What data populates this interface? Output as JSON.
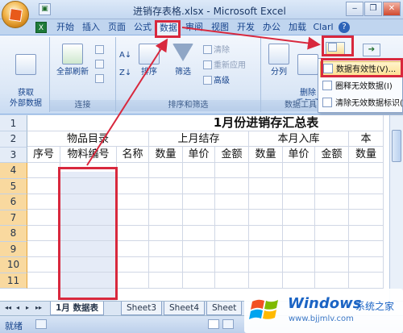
{
  "window": {
    "title": "进销存表格.xlsx - Microsoft Excel",
    "help_glyph": "?",
    "win_min": "‒",
    "win_restore": "❐",
    "win_close": "✕",
    "qat_icon": "save-icon"
  },
  "tabs": [
    {
      "label": "开始"
    },
    {
      "label": "插入"
    },
    {
      "label": "页面"
    },
    {
      "label": "公式"
    },
    {
      "label": "数据"
    },
    {
      "label": "审阅"
    },
    {
      "label": "视图"
    },
    {
      "label": "开发"
    },
    {
      "label": "办公"
    },
    {
      "label": "加载"
    },
    {
      "label": "Clarl"
    }
  ],
  "ribbon": {
    "get_external": {
      "label": "获取\n外部数据"
    },
    "connections": {
      "refresh_all": "全部刷新",
      "group_label": "连接"
    },
    "sort_filter": {
      "sort": "排序",
      "filter": "筛选",
      "clear": "清除",
      "reapply": "重新应用",
      "advanced": "高级",
      "group_label": "排序和筛选"
    },
    "data_tools": {
      "text_to_columns": "分列",
      "remove_duplicates": "删除\n重复项",
      "group_label": "数据工具"
    }
  },
  "dropdown": {
    "items": [
      {
        "label": "数据有效性(V)..."
      },
      {
        "label": "圈释无效数据(I)"
      },
      {
        "label": "清除无效数据标识(R)"
      }
    ]
  },
  "sheet": {
    "row_numbers": [
      "1",
      "2",
      "3",
      "4",
      "5",
      "6",
      "7",
      "8",
      "9",
      "10",
      "11"
    ],
    "title": "1月份进销存汇总表",
    "row2": {
      "c1": "物品目录",
      "c2": "上月结存",
      "c3": "本月入库",
      "c4": "本"
    },
    "row3": [
      "序号",
      "物料编号",
      "名称",
      "数量",
      "单价",
      "金额",
      "数量",
      "单价",
      "金额",
      "数量"
    ]
  },
  "sheet_tabs": {
    "tabs": [
      {
        "label": "1月 数据表"
      },
      {
        "label": "Sheet3"
      },
      {
        "label": "Sheet4"
      },
      {
        "label": "Sheet"
      }
    ],
    "nav": [
      "◂◂",
      "◂",
      "▸",
      "▸▸"
    ]
  },
  "status": {
    "ready": "就绪"
  },
  "watermark": {
    "brand": "Windows",
    "cn": "系统之家",
    "url": "www.bjjmlv.com"
  },
  "colors": {
    "highlight": "#d8283d",
    "accent": "#15428b"
  }
}
